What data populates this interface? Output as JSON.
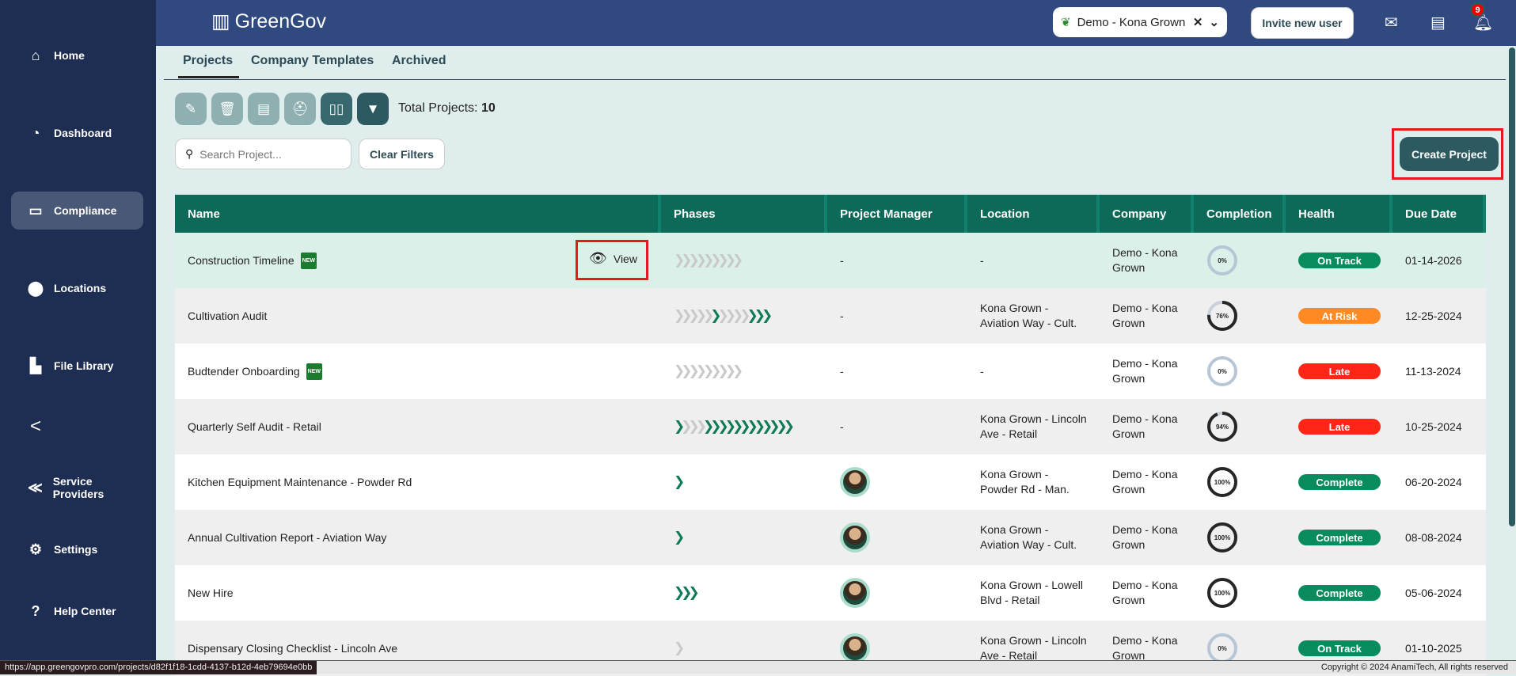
{
  "sidebar": {
    "items": [
      {
        "label": "Home",
        "icon": "home-icon",
        "glyph": "⌂"
      },
      {
        "label": "Dashboard",
        "icon": "pie-chart-icon",
        "glyph": "◔"
      },
      {
        "label": "Compliance",
        "icon": "inbox-icon",
        "glyph": "▭"
      },
      {
        "label": "Locations",
        "icon": "map-pin-icon",
        "glyph": "⬤"
      },
      {
        "label": "File Library",
        "icon": "file-icon",
        "glyph": "▙"
      },
      {
        "label": "Service Providers",
        "icon": "handshake-icon",
        "glyph": "≪"
      },
      {
        "label": "Settings",
        "icon": "gear-icon",
        "glyph": "⚙"
      },
      {
        "label": "Help Center",
        "icon": "help-icon",
        "glyph": "?"
      }
    ],
    "collapse": "<"
  },
  "header": {
    "brand": "GreenGov",
    "org": "Demo - Kona Grown",
    "invite": "Invite new user",
    "notifications": "9"
  },
  "tabs": [
    "Projects",
    "Company Templates",
    "Archived"
  ],
  "toolbar": {
    "total_label": "Total Projects:",
    "total": "10"
  },
  "search": {
    "placeholder": "Search Project..."
  },
  "clear_filters": "Clear Filters",
  "create_project": "Create Project",
  "view_label": "View",
  "new_badge": "NEW",
  "columns": [
    "Name",
    "Phases",
    "Project Manager",
    "Location",
    "Company",
    "Completion",
    "Health",
    "Due Date"
  ],
  "health_colors": {
    "On Track": "#088c5e",
    "At Risk": "#ff8a23",
    "Late": "#ff2618",
    "Complete": "#088c5e"
  },
  "rows": [
    {
      "name": "Construction Timeline",
      "new": true,
      "phases": "xxxxxxxxx",
      "pm": "-",
      "location": "-",
      "company": "Demo - Kona Grown",
      "completion": 0,
      "completion_label": "0%",
      "health": "On Track",
      "due": "01-14-2026"
    },
    {
      "name": "Cultivation Audit",
      "new": false,
      "phases": "xxxxxgxxxxggg",
      "pm": "-",
      "location": "Kona Grown - Aviation Way - Cult.",
      "company": "Demo - Kona Grown",
      "completion": 76,
      "completion_label": "76%",
      "health": "At Risk",
      "due": "12-25-2024"
    },
    {
      "name": "Budtender Onboarding",
      "new": true,
      "phases": "xxxxxxxxx",
      "pm": "-",
      "location": "-",
      "company": "Demo - Kona Grown",
      "completion": 0,
      "completion_label": "0%",
      "health": "Late",
      "due": "11-13-2024"
    },
    {
      "name": "Quarterly Self Audit - Retail",
      "new": false,
      "phases": "gxxxgggggggggggg",
      "pm": "-",
      "location": "Kona Grown - Lincoln Ave - Retail",
      "company": "Demo - Kona Grown",
      "completion": 94,
      "completion_label": "94%",
      "health": "Late",
      "due": "10-25-2024"
    },
    {
      "name": "Kitchen Equipment Maintenance - Powder Rd",
      "new": false,
      "phases": "g",
      "pm": "avatar",
      "location": "Kona Grown - Powder Rd - Man.",
      "company": "Demo - Kona Grown",
      "completion": 100,
      "completion_label": "100%",
      "health": "Complete",
      "due": "06-20-2024"
    },
    {
      "name": "Annual Cultivation Report - Aviation Way",
      "new": false,
      "phases": "g",
      "pm": "avatar",
      "location": "Kona Grown - Aviation Way - Cult.",
      "company": "Demo - Kona Grown",
      "completion": 100,
      "completion_label": "100%",
      "health": "Complete",
      "due": "08-08-2024"
    },
    {
      "name": "New Hire",
      "new": false,
      "phases": "ggg",
      "pm": "avatar",
      "location": "Kona Grown - Lowell Blvd - Retail",
      "company": "Demo - Kona Grown",
      "completion": 100,
      "completion_label": "100%",
      "health": "Complete",
      "due": "05-06-2024"
    },
    {
      "name": "Dispensary Closing Checklist - Lincoln Ave",
      "new": false,
      "phases": "x",
      "pm": "avatar",
      "location": "Kona Grown - Lincoln Ave - Retail",
      "company": "Demo - Kona Grown",
      "completion": 0,
      "completion_label": "0%",
      "health": "On Track",
      "due": "01-10-2025"
    }
  ],
  "statusbar": {
    "url": "https://app.greengovpro.com/projects/d82f1f18-1cdd-4137-b12d-4eb79694e0bb",
    "copyright": "Copyright © 2024 AnamiTech, All rights reserved"
  }
}
